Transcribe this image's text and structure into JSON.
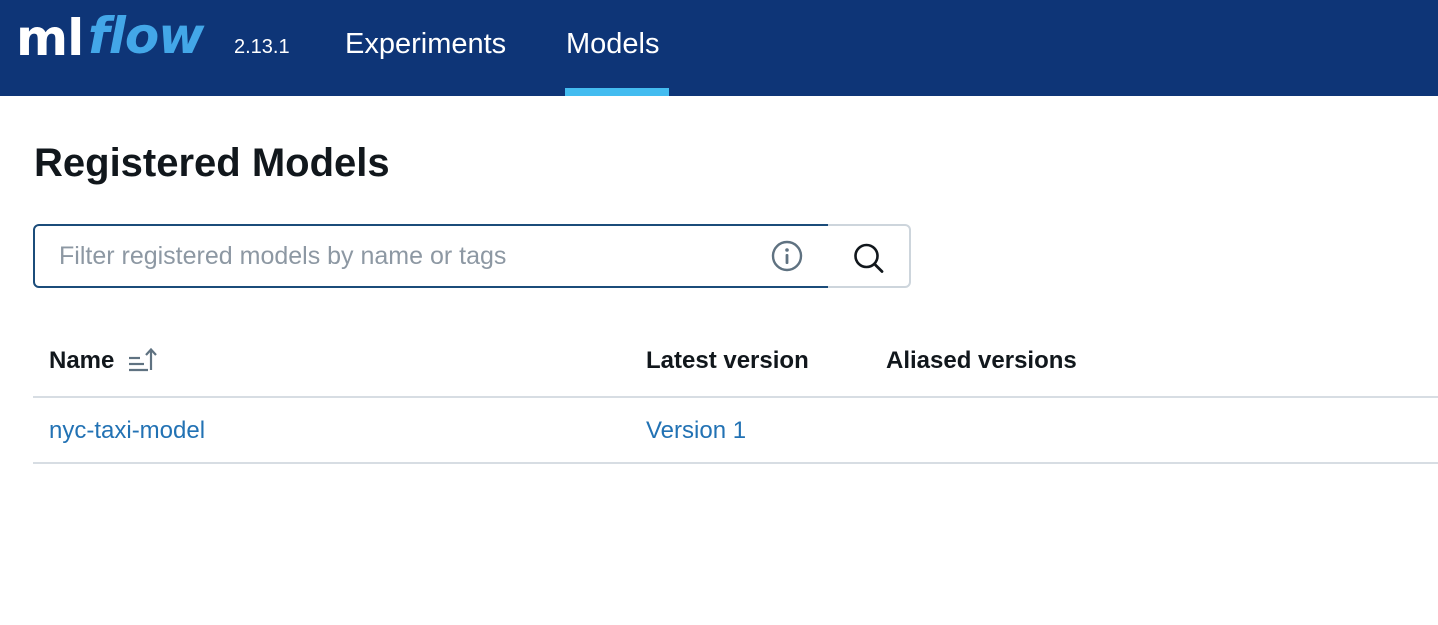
{
  "header": {
    "logo_ml": "ml",
    "logo_flow": "flow",
    "version": "2.13.1",
    "nav": [
      {
        "label": "Experiments",
        "active": false
      },
      {
        "label": "Models",
        "active": true
      }
    ],
    "colors": {
      "background": "#0e3577",
      "accent": "#43bcf0",
      "logo_blue": "#43a7e8"
    }
  },
  "page": {
    "title": "Registered Models"
  },
  "search": {
    "placeholder": "Filter registered models by name or tags",
    "value": "",
    "info_icon": "info-icon",
    "button_icon": "search-icon"
  },
  "table": {
    "columns": [
      {
        "label": "Name",
        "sort": "ascending"
      },
      {
        "label": "Latest version"
      },
      {
        "label": "Aliased versions"
      }
    ],
    "rows": [
      {
        "name": "nyc-taxi-model",
        "latest_version": "Version 1",
        "aliased_versions": ""
      }
    ],
    "link_color": "#2272b4"
  }
}
